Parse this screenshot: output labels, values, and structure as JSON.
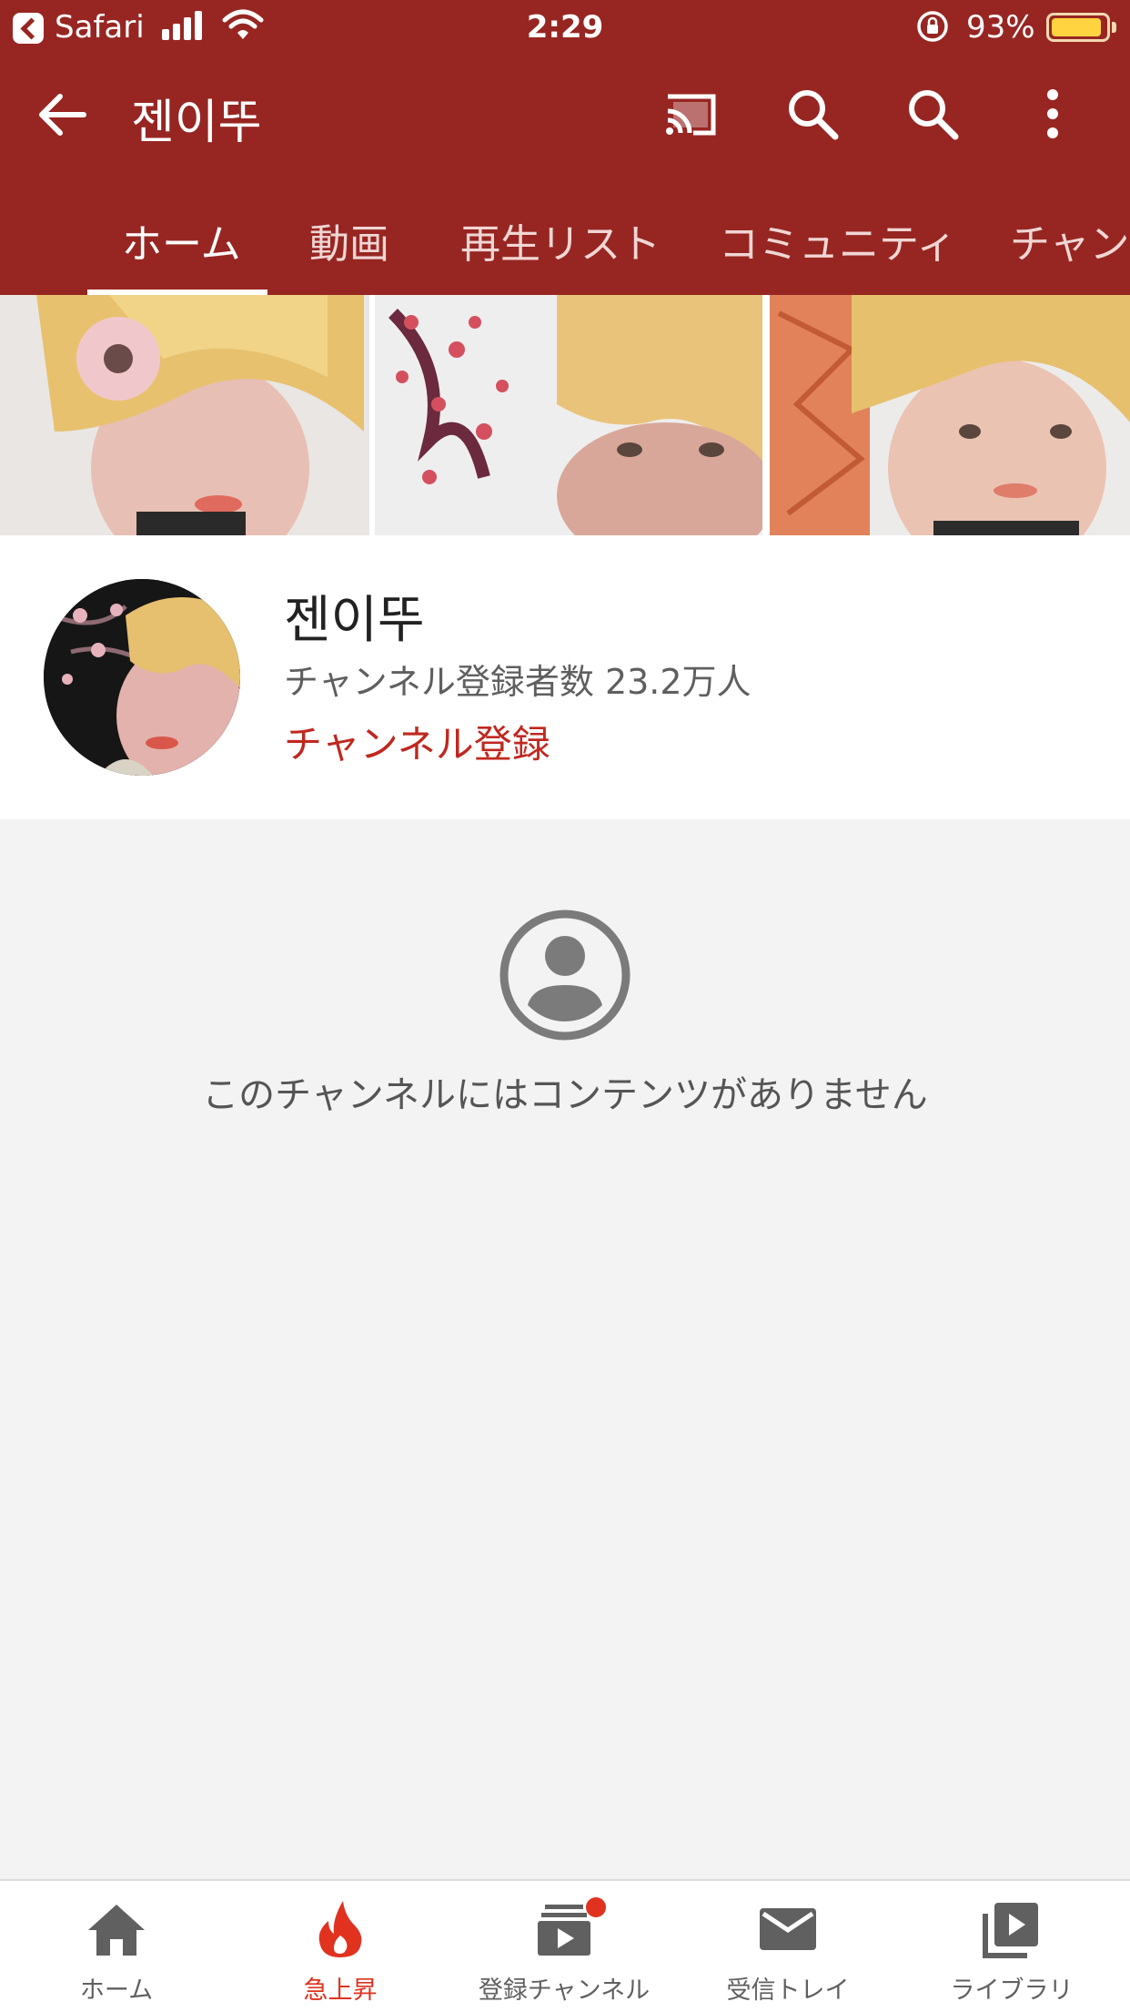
{
  "status_bar": {
    "back_app": "Safari",
    "time": "2:29",
    "battery_pct": "93%",
    "battery_level": 0.93
  },
  "header": {
    "title": "젠이뚜",
    "icons": [
      "arrow-back-icon",
      "cast-icon",
      "search-icon",
      "search-icon",
      "more-vert-icon"
    ],
    "accent_color": "#972622"
  },
  "tabs": [
    {
      "label": "ホーム",
      "active": true
    },
    {
      "label": "動画"
    },
    {
      "label": "再生リスト"
    },
    {
      "label": "コミュニティ"
    },
    {
      "label": "チャンネル"
    }
  ],
  "channel": {
    "name": "젠이뚜",
    "subscribers": "チャンネル登録者数 23.2万人",
    "subscribe_label": "チャンネル登録"
  },
  "empty_state": {
    "icon": "account-circle-icon",
    "message": "このチャンネルにはコンテンツがありません"
  },
  "bottom_nav": [
    {
      "label": "ホーム",
      "icon": "home-icon"
    },
    {
      "label": "急上昇",
      "icon": "trending-fire-icon",
      "active": true
    },
    {
      "label": "登録チャンネル",
      "icon": "subscriptions-icon",
      "badge": true
    },
    {
      "label": "受信トレイ",
      "icon": "mail-icon"
    },
    {
      "label": "ライブラリ",
      "icon": "library-icon"
    }
  ]
}
